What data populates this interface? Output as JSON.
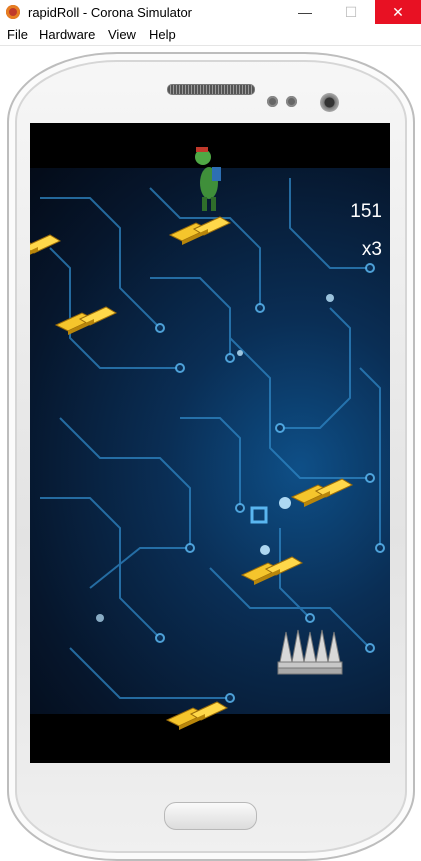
{
  "window": {
    "title": "rapidRoll - Corona Simulator",
    "minimize_label": "—",
    "maximize_label": "☐",
    "close_label": "✕"
  },
  "menu": {
    "items": [
      {
        "label": "File"
      },
      {
        "label": "Hardware"
      },
      {
        "label": "View"
      },
      {
        "label": "Help"
      }
    ]
  },
  "game": {
    "score": "151",
    "lives": "x3",
    "colors": {
      "gold": "#e8b419",
      "circuit": "#3fa9e6",
      "background": "#0a2e55"
    }
  }
}
